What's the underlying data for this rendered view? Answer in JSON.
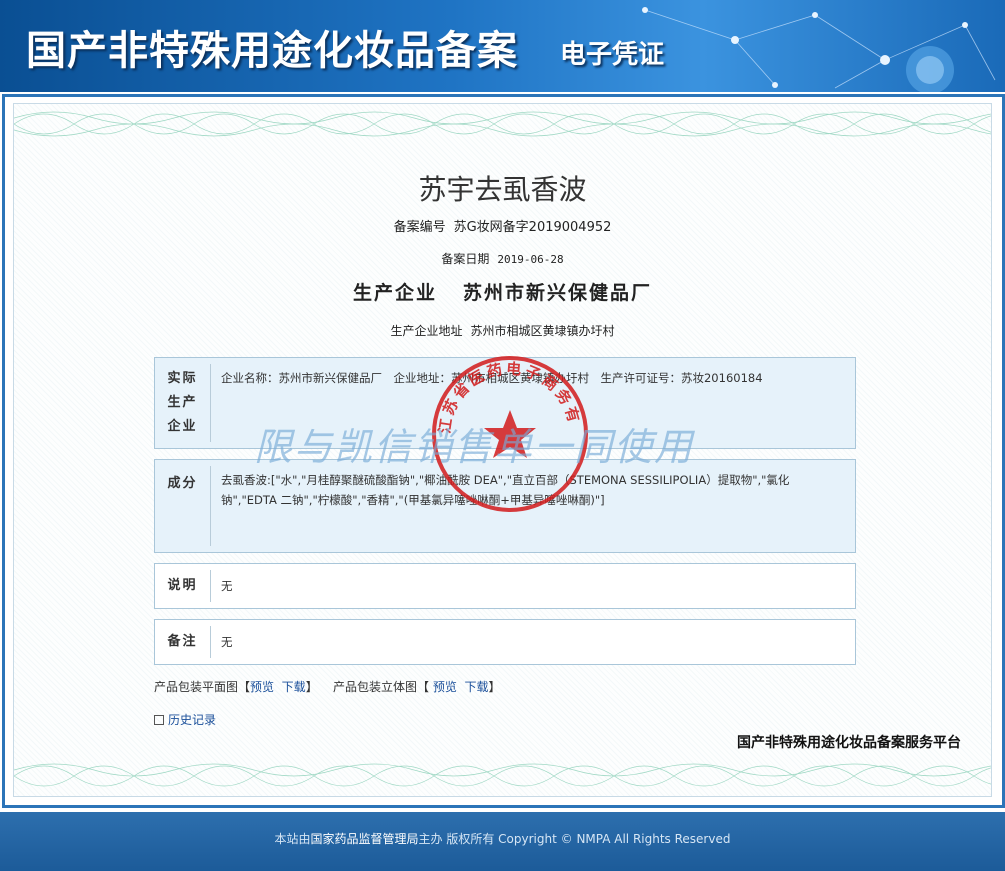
{
  "header": {
    "title": "国产非特殊用途化妆品备案",
    "subtitle": "电子凭证"
  },
  "certificate": {
    "product_name": "苏宇去虱香波",
    "record_no_label": "备案编号",
    "record_no": "苏G妆网备字2019004952",
    "record_date_label": "备案日期",
    "record_date": "2019-06-28",
    "manufacturer_label": "生产企业",
    "manufacturer": "苏州市新兴保健品厂",
    "address_label": "生产企业地址",
    "address": "苏州市相城区黄埭镇办圩村"
  },
  "sections": {
    "actual_producer": {
      "head": "实际生产企业",
      "content": "企业名称：苏州市新兴保健品厂　企业地址：苏州市相城区黄埭镇办圩村　生产许可证号：苏妆20160184"
    },
    "ingredients": {
      "head": "成分",
      "content": "去虱香波:[\"水\",\"月桂醇聚醚硫酸酯钠\",\"椰油酰胺 DEA\",\"直立百部（STEMONA SESSILIPOLIA）提取物\",\"氯化钠\",\"EDTA 二钠\",\"柠檬酸\",\"香精\",\"(甲基氯异噻唑啉酮+甲基异噻唑啉酮)\"]"
    },
    "description": {
      "head": "说明",
      "content": "无"
    },
    "remarks": {
      "head": "备注",
      "content": "无"
    }
  },
  "links": {
    "flat_label": "产品包装平面图【",
    "preview": "预览",
    "download": "下载",
    "close": "】",
    "solid_label": "产品包装立体图【"
  },
  "history": "历史记录",
  "platform": "国产非特殊用途化妆品备案服务平台",
  "watermark": "限与凯信销售单一同使用",
  "seal_text": "江苏省医药电子商务有限公司",
  "footer": {
    "prefix": "本站由",
    "org": "国家药品监督管理局",
    "suffix": "主办 版权所有 Copyright © NMPA All Rights Reserved"
  }
}
